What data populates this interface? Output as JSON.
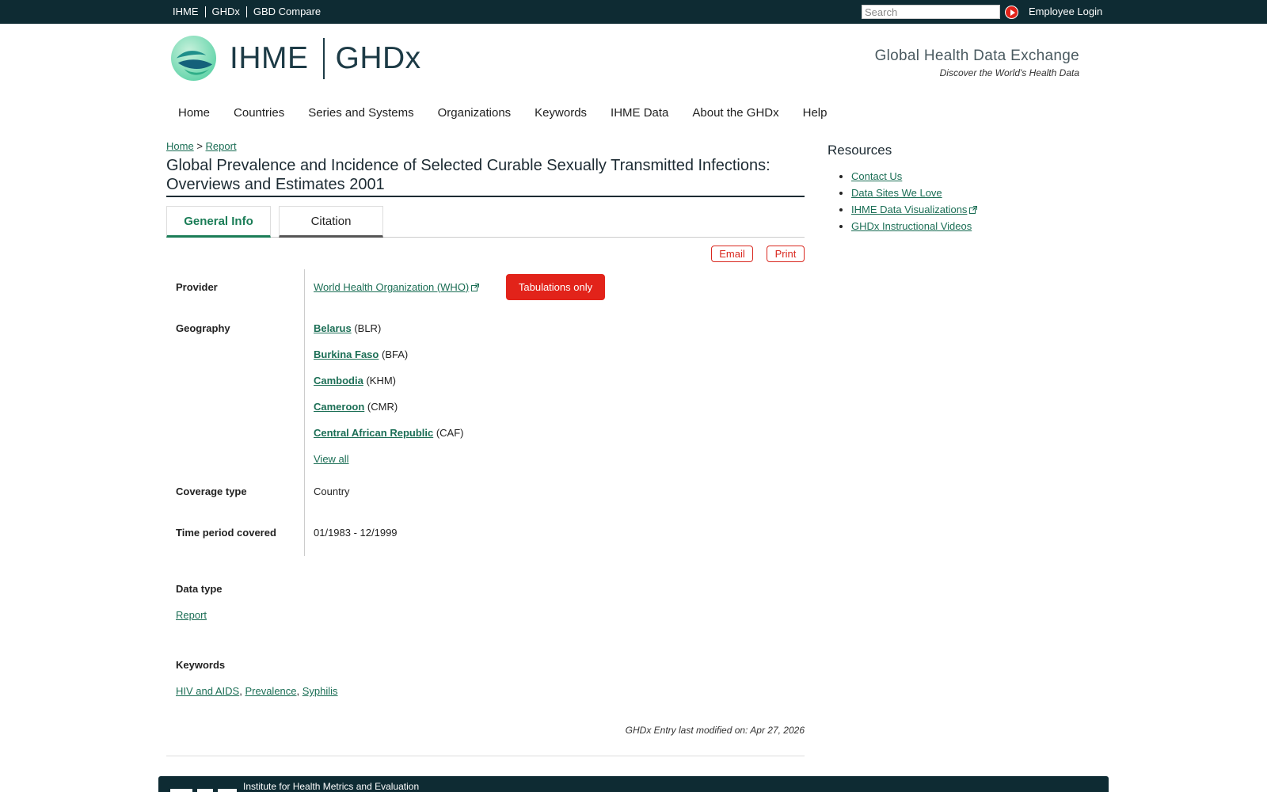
{
  "topnav": {
    "links": [
      "IHME",
      "GHDx",
      "GBD Compare"
    ],
    "search_placeholder": "Search",
    "login": "Employee Login"
  },
  "header": {
    "brand_left": "IHME",
    "brand_right": "GHDx",
    "tagline_title": "Global Health Data Exchange",
    "tagline_sub": "Discover the World's Health Data"
  },
  "mainnav": [
    "Home",
    "Countries",
    "Series and Systems",
    "Organizations",
    "Keywords",
    "IHME Data",
    "About the GHDx",
    "Help"
  ],
  "breadcrumb": {
    "home": "Home",
    "sep": ">",
    "current": "Report"
  },
  "title": "Global Prevalence and Incidence of Selected Curable Sexually Transmitted Infections: Overviews and Estimates 2001",
  "tabs": [
    "General Info",
    "Citation"
  ],
  "actions": {
    "email": "Email",
    "print": "Print"
  },
  "record": {
    "provider_label": "Provider",
    "provider_value": "World Health Organization (WHO)",
    "tabulations": "Tabulations only",
    "geography_label": "Geography",
    "geography": [
      {
        "name": "Belarus",
        "code": "(BLR)"
      },
      {
        "name": "Burkina Faso",
        "code": "(BFA)"
      },
      {
        "name": "Cambodia",
        "code": "(KHM)"
      },
      {
        "name": "Cameroon",
        "code": "(CMR)"
      },
      {
        "name": "Central African Republic",
        "code": "(CAF)"
      }
    ],
    "view_all": "View all",
    "coverage_label": "Coverage type",
    "coverage_value": "Country",
    "time_label": "Time period covered",
    "time_value": "01/1983 - 12/1999",
    "datatype_label": "Data type",
    "datatype_value": "Report",
    "keywords_label": "Keywords",
    "keywords": [
      "HIV and AIDS",
      "Prevalence",
      "Syphilis"
    ],
    "keyword_sep": ","
  },
  "modified": "GHDx Entry last modified on: Apr 27, 2026",
  "resources": {
    "title": "Resources",
    "items": [
      "Contact Us",
      "Data Sites We Love",
      "IHME Data Visualizations",
      "GHDx Instructional Videos"
    ]
  },
  "footer": {
    "text": "Institute for Health Metrics and Evaluation"
  },
  "colors": {
    "topbar": "#0e2b33",
    "accent": "#e2231a",
    "link": "#1b6e55",
    "active_tab": "#1b7d57"
  }
}
